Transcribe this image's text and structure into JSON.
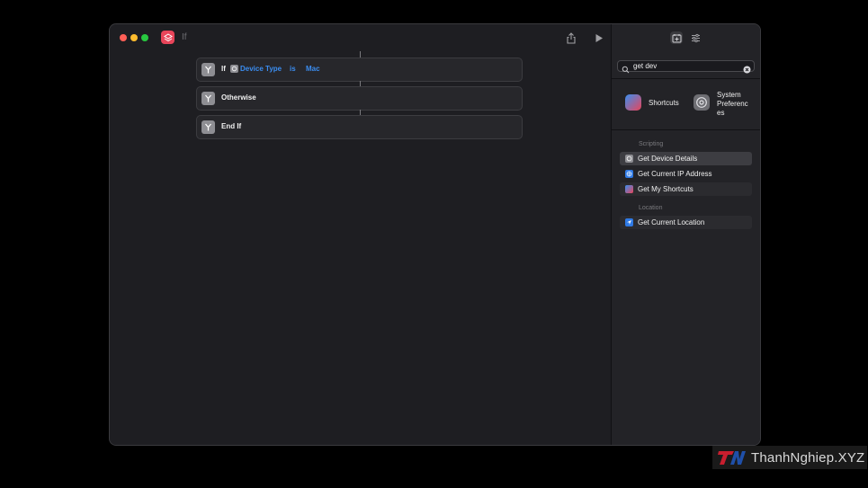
{
  "window": {
    "title": "If"
  },
  "editor": {
    "actions": [
      {
        "label": "If",
        "variable": "Device Type",
        "operator": "is",
        "value": "Mac"
      },
      {
        "label": "Otherwise"
      },
      {
        "label": "End If"
      }
    ]
  },
  "sidebar": {
    "search": {
      "value": "get dev"
    },
    "apps": [
      {
        "label": "Shortcuts"
      },
      {
        "label": "System Preferenc es"
      }
    ],
    "sections": [
      {
        "header": "Scripting",
        "items": [
          {
            "label": "Get Device Details",
            "icon": "device-icon"
          },
          {
            "label": "Get Current IP Address",
            "icon": "network-icon"
          },
          {
            "label": "Get My Shortcuts",
            "icon": "shortcuts-icon"
          }
        ]
      },
      {
        "header": "Location",
        "items": [
          {
            "label": "Get Current Location",
            "icon": "location-arrow-icon"
          }
        ]
      }
    ]
  },
  "watermark": {
    "text": "ThanhNghiep.XYZ",
    "logo": "TN"
  },
  "colors": {
    "accent": "#3b8df0",
    "window_bg": "#1e1e22",
    "sidebar_bg": "#232327",
    "app_icon": "#e8455a"
  }
}
